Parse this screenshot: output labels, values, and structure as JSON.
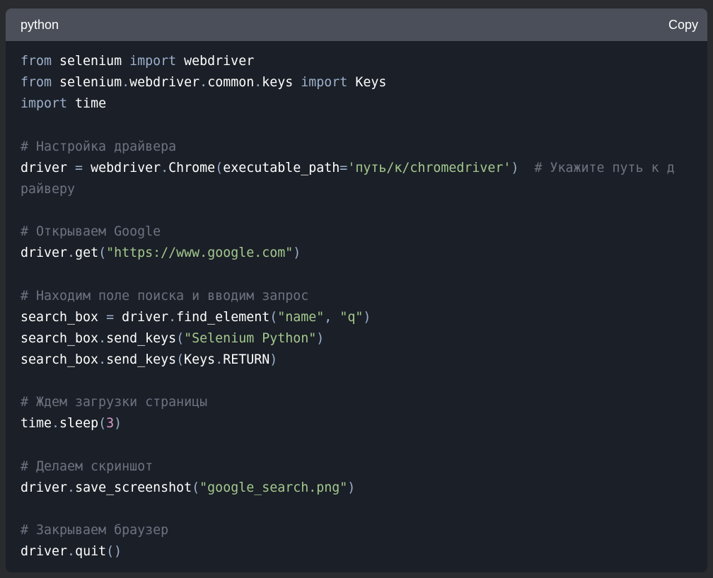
{
  "header": {
    "language": "python",
    "copy_label": "Copy"
  },
  "colors": {
    "background": "#2a2b2e",
    "header_bg": "#4b4f59",
    "code_bg": "#1b1f27",
    "keyword": "#9cb0cc",
    "string": "#a3c98e",
    "number": "#d59ac9",
    "comment": "#6d7381",
    "identifier": "#ffffff"
  },
  "code_lines": [
    [
      {
        "t": "kw",
        "v": "from"
      },
      {
        "t": "id",
        "v": " selenium "
      },
      {
        "t": "kw",
        "v": "import"
      },
      {
        "t": "id",
        "v": " webdriver"
      }
    ],
    [
      {
        "t": "kw",
        "v": "from"
      },
      {
        "t": "id",
        "v": " selenium"
      },
      {
        "t": "pn",
        "v": "."
      },
      {
        "t": "id",
        "v": "webdriver"
      },
      {
        "t": "pn",
        "v": "."
      },
      {
        "t": "id",
        "v": "common"
      },
      {
        "t": "pn",
        "v": "."
      },
      {
        "t": "id",
        "v": "keys "
      },
      {
        "t": "kw",
        "v": "import"
      },
      {
        "t": "id",
        "v": " Keys"
      }
    ],
    [
      {
        "t": "kw",
        "v": "import"
      },
      {
        "t": "id",
        "v": " time"
      }
    ],
    [],
    [
      {
        "t": "cm",
        "v": "# Настройка драйвера"
      }
    ],
    [
      {
        "t": "id",
        "v": "driver "
      },
      {
        "t": "pn",
        "v": "="
      },
      {
        "t": "id",
        "v": " webdriver"
      },
      {
        "t": "pn",
        "v": "."
      },
      {
        "t": "id",
        "v": "Chrome"
      },
      {
        "t": "pn",
        "v": "("
      },
      {
        "t": "id",
        "v": "executable_path"
      },
      {
        "t": "pn",
        "v": "="
      },
      {
        "t": "str",
        "v": "'путь/к/chromedriver'"
      },
      {
        "t": "pn",
        "v": ")"
      },
      {
        "t": "id",
        "v": "  "
      },
      {
        "t": "cm",
        "v": "# Укажите путь к д"
      }
    ],
    [
      {
        "t": "cm",
        "v": "райверу"
      }
    ],
    [],
    [
      {
        "t": "cm",
        "v": "# Открываем Google"
      }
    ],
    [
      {
        "t": "id",
        "v": "driver"
      },
      {
        "t": "pn",
        "v": "."
      },
      {
        "t": "id",
        "v": "get"
      },
      {
        "t": "pn",
        "v": "("
      },
      {
        "t": "str",
        "v": "\"https://www.google.com\""
      },
      {
        "t": "pn",
        "v": ")"
      }
    ],
    [],
    [
      {
        "t": "cm",
        "v": "# Находим поле поиска и вводим запрос"
      }
    ],
    [
      {
        "t": "id",
        "v": "search_box "
      },
      {
        "t": "pn",
        "v": "="
      },
      {
        "t": "id",
        "v": " driver"
      },
      {
        "t": "pn",
        "v": "."
      },
      {
        "t": "id",
        "v": "find_element"
      },
      {
        "t": "pn",
        "v": "("
      },
      {
        "t": "str",
        "v": "\"name\""
      },
      {
        "t": "pn",
        "v": ", "
      },
      {
        "t": "str",
        "v": "\"q\""
      },
      {
        "t": "pn",
        "v": ")"
      }
    ],
    [
      {
        "t": "id",
        "v": "search_box"
      },
      {
        "t": "pn",
        "v": "."
      },
      {
        "t": "id",
        "v": "send_keys"
      },
      {
        "t": "pn",
        "v": "("
      },
      {
        "t": "str",
        "v": "\"Selenium Python\""
      },
      {
        "t": "pn",
        "v": ")"
      }
    ],
    [
      {
        "t": "id",
        "v": "search_box"
      },
      {
        "t": "pn",
        "v": "."
      },
      {
        "t": "id",
        "v": "send_keys"
      },
      {
        "t": "pn",
        "v": "("
      },
      {
        "t": "id",
        "v": "Keys"
      },
      {
        "t": "pn",
        "v": "."
      },
      {
        "t": "id",
        "v": "RETURN"
      },
      {
        "t": "pn",
        "v": ")"
      }
    ],
    [],
    [
      {
        "t": "cm",
        "v": "# Ждем загрузки страницы"
      }
    ],
    [
      {
        "t": "id",
        "v": "time"
      },
      {
        "t": "pn",
        "v": "."
      },
      {
        "t": "id",
        "v": "sleep"
      },
      {
        "t": "pn",
        "v": "("
      },
      {
        "t": "num",
        "v": "3"
      },
      {
        "t": "pn",
        "v": ")"
      }
    ],
    [],
    [
      {
        "t": "cm",
        "v": "# Делаем скриншот"
      }
    ],
    [
      {
        "t": "id",
        "v": "driver"
      },
      {
        "t": "pn",
        "v": "."
      },
      {
        "t": "id",
        "v": "save_screenshot"
      },
      {
        "t": "pn",
        "v": "("
      },
      {
        "t": "str",
        "v": "\"google_search.png\""
      },
      {
        "t": "pn",
        "v": ")"
      }
    ],
    [],
    [
      {
        "t": "cm",
        "v": "# Закрываем браузер"
      }
    ],
    [
      {
        "t": "id",
        "v": "driver"
      },
      {
        "t": "pn",
        "v": "."
      },
      {
        "t": "id",
        "v": "quit"
      },
      {
        "t": "pn",
        "v": "()"
      }
    ]
  ]
}
